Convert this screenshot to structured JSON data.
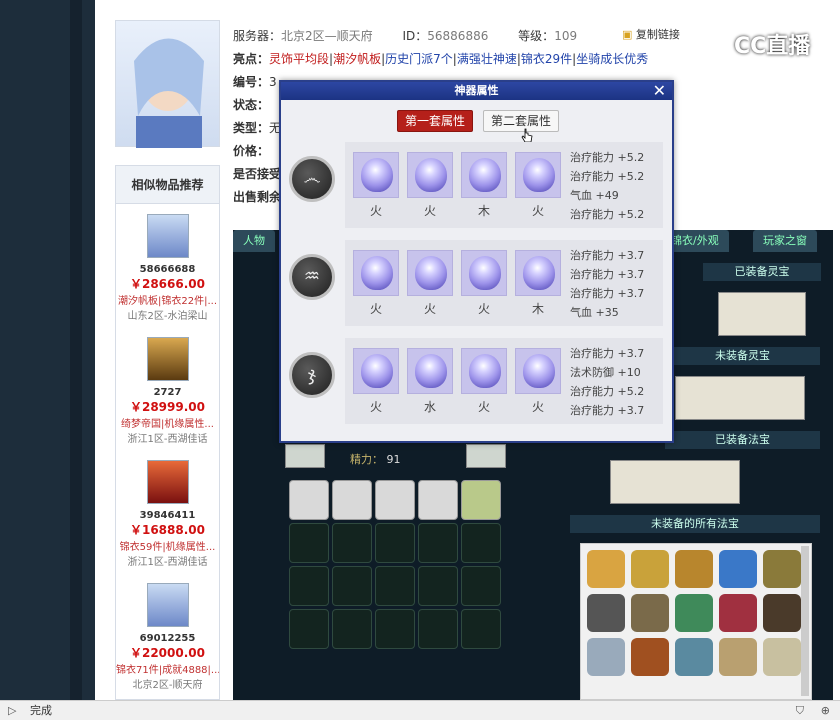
{
  "page": {
    "server_label": "服务器：",
    "server_value": "北京2区—顺天府",
    "id_label": "ID：",
    "id_value": "56886886",
    "level_label": "等级：",
    "level_value": "109",
    "copy_link": "复制链接",
    "highlights_label": "亮点：",
    "highlights": [
      "灵饰平均段",
      "潮汐帆板",
      "历史门派7个",
      "满强壮神速",
      "锦衣29件",
      "坐骑成长优秀"
    ],
    "row_labels": [
      "编号：",
      "状态：",
      "类型：",
      "价格："
    ],
    "row_values": [
      "3",
      "",
      "无",
      ""
    ],
    "receive_label": "是否接受",
    "remaining_label": "出售剩余"
  },
  "logo": {
    "text": "CC直播"
  },
  "similar": {
    "header": "相似物品推荐",
    "items": [
      {
        "id": "58666688",
        "price": "￥28666.00",
        "tags": "潮汐帆板|锦衣22件|...",
        "server": "山东2区-水泊梁山"
      },
      {
        "id": "2727",
        "price": "￥28999.00",
        "tags": "绮梦帝国|机缘属性...",
        "server": "浙江1区-西湖佳话"
      },
      {
        "id": "39846411",
        "price": "￥16888.00",
        "tags": "锦衣59件|机缘属性...",
        "server": "浙江1区-西湖佳话"
      },
      {
        "id": "69012255",
        "price": "￥22000.00",
        "tags": "锦衣71件|成就4888|...",
        "server": "北京2区-顺天府"
      }
    ]
  },
  "tabs": [
    "人物",
    "锦衣/外观",
    "玩家之窗"
  ],
  "equip": {
    "equipped_lingbao": "已装备灵宝",
    "unequipped_lingbao": "未装备灵宝",
    "equipped_fabao": "已装备法宝",
    "unequipped_all_fabao": "未装备的所有法宝",
    "jingli_label": "精力：",
    "jingli_value": "91"
  },
  "modal": {
    "title": "神器属性",
    "close": "✕",
    "tab1": "第一套属性",
    "tab2": "第二套属性",
    "sets": [
      {
        "elements": [
          "火",
          "火",
          "木",
          "火"
        ],
        "attrs": [
          "治疗能力 +5.2",
          "治疗能力 +5.2",
          "气血 +49",
          "治疗能力 +5.2"
        ]
      },
      {
        "elements": [
          "火",
          "火",
          "火",
          "木"
        ],
        "attrs": [
          "治疗能力 +3.7",
          "治疗能力 +3.7",
          "治疗能力 +3.7",
          "气血 +35"
        ]
      },
      {
        "elements": [
          "火",
          "水",
          "火",
          "火"
        ],
        "attrs": [
          "治疗能力 +3.7",
          "法术防御 +10",
          "治疗能力 +5.2",
          "治疗能力 +3.7"
        ]
      }
    ]
  },
  "statusbar": {
    "text": "完成"
  }
}
